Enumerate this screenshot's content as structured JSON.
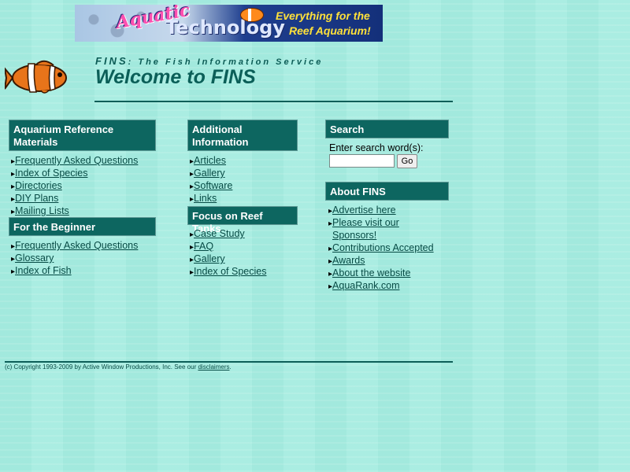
{
  "banner": {
    "brand1": "Aquatic",
    "brand2": "Technology",
    "tagline1": "Everything for the",
    "tagline2": "Reef Aquarium!"
  },
  "header": {
    "fins_abbrev": "FINS",
    "fins_full": ": The Fish Information Service",
    "welcome": "Welcome to FINS"
  },
  "aquarium_reference": {
    "title_line1": "Aquarium Reference",
    "title_line2": "Materials",
    "items": [
      "Frequently Asked Questions",
      "Index of Species",
      "Directories",
      "DIY Plans",
      "Mailing Lists"
    ]
  },
  "beginner": {
    "title": "For the Beginner",
    "items": [
      "Frequently Asked Questions",
      "Glossary",
      "Index of Fish"
    ]
  },
  "additional": {
    "title_line1": "Additional",
    "title_line2": "Information",
    "items": [
      "Articles",
      "Gallery",
      "Software",
      "Links"
    ]
  },
  "reef": {
    "title": "Focus on Reef Tanks",
    "items": [
      "Case Study",
      "FAQ",
      "Gallery",
      "Index of Species"
    ]
  },
  "search": {
    "title": "Search",
    "label": "Enter search word(s):",
    "value": "",
    "go_label": "Go"
  },
  "about": {
    "title": "About FINS",
    "items": [
      "Advertise here",
      "Please visit our",
      "Sponsors!",
      "Contributions Accepted",
      "Awards ",
      "About the website",
      "AquaRank.com"
    ]
  },
  "footer": {
    "copyright": "(c) Copyright 1993-2009 by Active Window Productions, Inc. See our ",
    "disclaimers": "disclaimers",
    "period": "."
  },
  "colors": {
    "background": "#a6ece0",
    "section_header": "#0d6660",
    "heading_text": "#0b5f58"
  }
}
